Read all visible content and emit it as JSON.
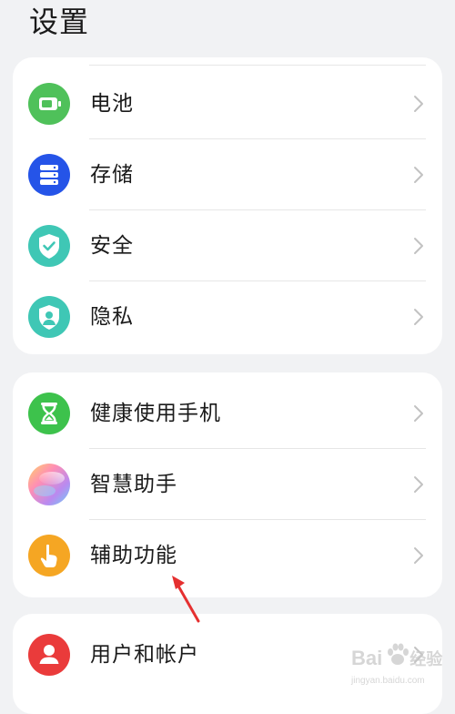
{
  "header": {
    "title": "设置"
  },
  "groups": [
    {
      "items": [
        {
          "label": "电池",
          "icon": "battery-icon",
          "icon_color": "#4fc15a"
        },
        {
          "label": "存储",
          "icon": "storage-icon",
          "icon_color": "#2554e8"
        },
        {
          "label": "安全",
          "icon": "security-shield-icon",
          "icon_color": "#3fc7b5"
        },
        {
          "label": "隐私",
          "icon": "privacy-shield-icon",
          "icon_color": "#3fc7b5"
        }
      ]
    },
    {
      "items": [
        {
          "label": "健康使用手机",
          "icon": "hourglass-icon",
          "icon_color": "#3dc24c"
        },
        {
          "label": "智慧助手",
          "icon": "assistant-gradient-icon",
          "icon_color": "#c98ae6"
        },
        {
          "label": "辅助功能",
          "icon": "hand-pointer-icon",
          "icon_color": "#f5a623"
        }
      ]
    },
    {
      "items": [
        {
          "label": "用户和帐户",
          "icon": "user-icon",
          "icon_color": "#ea3b3b"
        }
      ]
    }
  ],
  "annotation": {
    "icon": "red-arrow-icon",
    "color": "#e53030",
    "points_to": "辅助功能"
  },
  "watermark": {
    "brand": "Bai",
    "brand_suffix": "经验",
    "sub": "jingyan.baidu.com",
    "icon": "baidu-paw-icon"
  }
}
